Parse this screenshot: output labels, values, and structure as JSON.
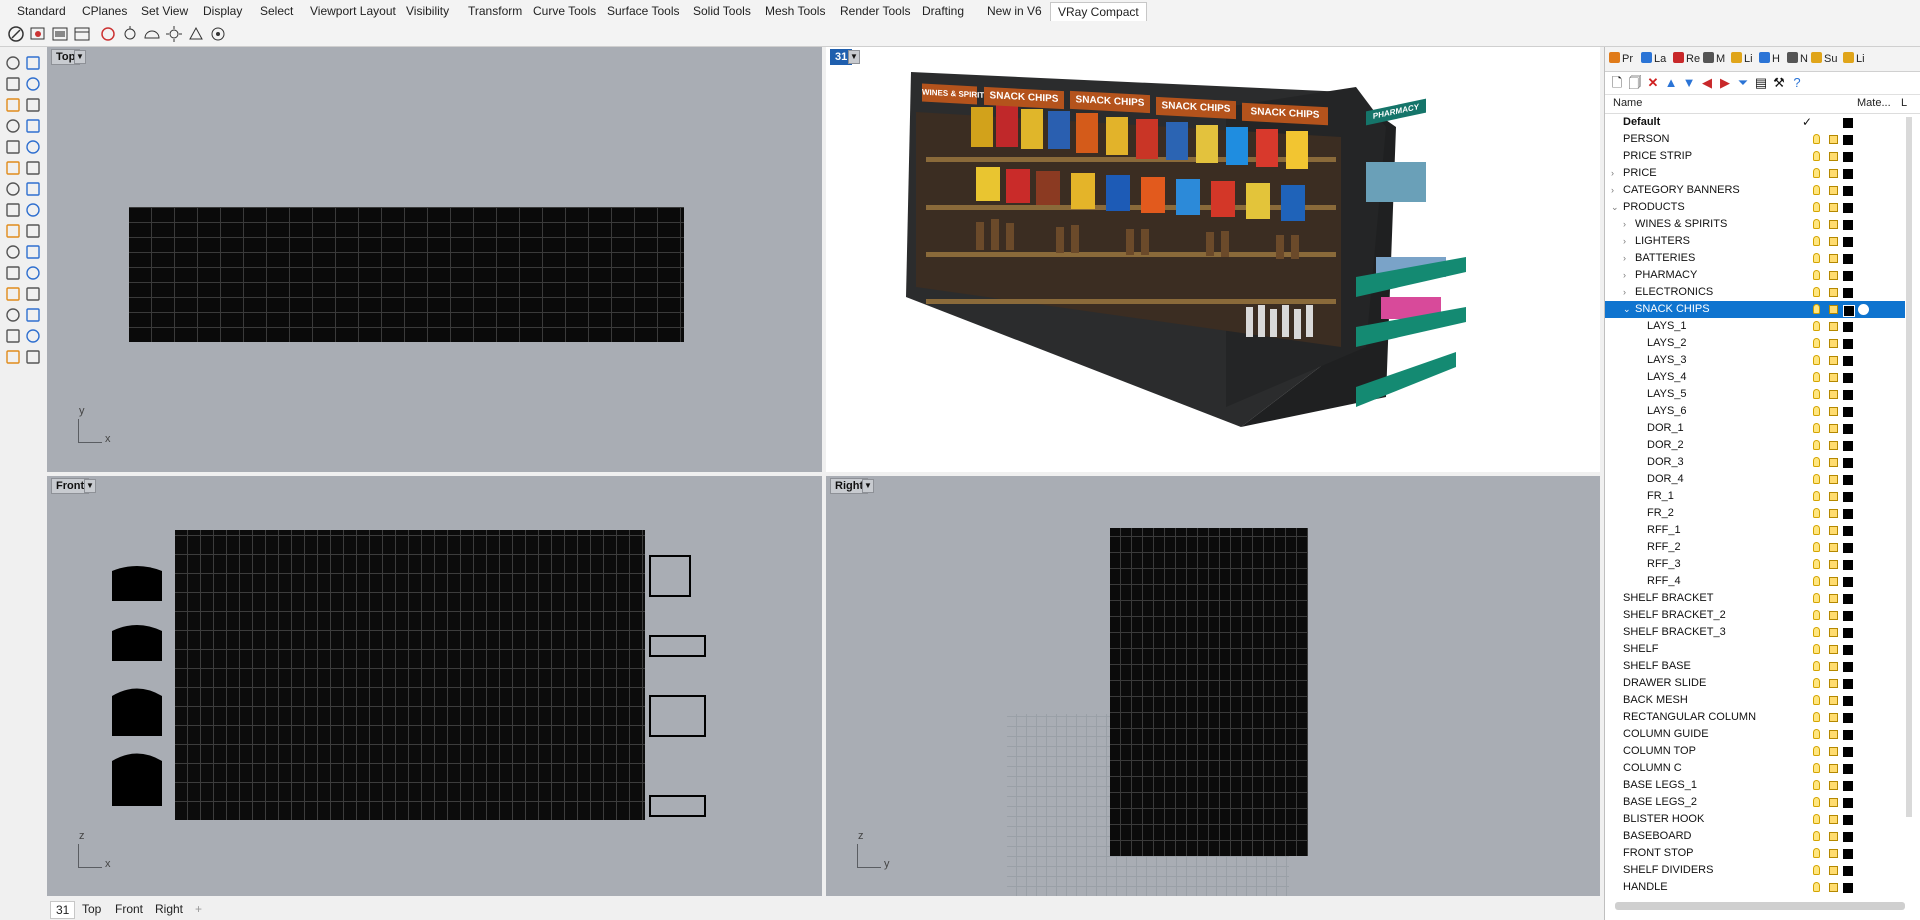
{
  "ribbon_tabs": [
    "Standard",
    "CPlanes",
    "Set View",
    "Display",
    "Select",
    "Viewport Layout",
    "Visibility",
    "Transform",
    "Curve Tools",
    "Surface Tools",
    "Solid Tools",
    "Mesh Tools",
    "Render Tools",
    "Drafting",
    "New in V6",
    "VRay Compact"
  ],
  "ribbon_active": "VRay Compact",
  "viewports": {
    "top": {
      "label": "Top",
      "axis_v": "y",
      "axis_h": "x"
    },
    "perspective": {
      "label": "31"
    },
    "front": {
      "label": "Front",
      "axis_v": "z",
      "axis_h": "x"
    },
    "right": {
      "label": "Right",
      "axis_v": "z",
      "axis_h": "y"
    }
  },
  "render_text": {
    "wines": "WINES & SPIRITS",
    "snack1": "SNACK CHIPS",
    "snack2": "SNACK CHIPS",
    "snack3": "SNACK CHIPS",
    "snack4": "SNACK CHIPS",
    "pharmacy": "PHARMACY"
  },
  "viewport_tabs": [
    "31",
    "Top",
    "Front",
    "Right"
  ],
  "panel": {
    "tabs": [
      "Pr",
      "La",
      "Re",
      "M",
      "Li",
      "H",
      "N",
      "Su",
      "Li"
    ],
    "columns": {
      "name": "Name",
      "material": "Mate...",
      "extra": "L"
    },
    "layers": [
      {
        "name": "Default",
        "depth": 0,
        "expander": "",
        "bold": true,
        "current": true
      },
      {
        "name": "PERSON",
        "depth": 0,
        "expander": ""
      },
      {
        "name": "PRICE STRIP",
        "depth": 0,
        "expander": ""
      },
      {
        "name": "PRICE",
        "depth": 0,
        "expander": ">"
      },
      {
        "name": "CATEGORY BANNERS",
        "depth": 0,
        "expander": ">"
      },
      {
        "name": "PRODUCTS",
        "depth": 0,
        "expander": "v"
      },
      {
        "name": "WINES & SPIRITS",
        "depth": 1,
        "expander": ">"
      },
      {
        "name": "LIGHTERS",
        "depth": 1,
        "expander": ">"
      },
      {
        "name": "BATTERIES",
        "depth": 1,
        "expander": ">"
      },
      {
        "name": "PHARMACY",
        "depth": 1,
        "expander": ">"
      },
      {
        "name": "ELECTRONICS",
        "depth": 1,
        "expander": ">"
      },
      {
        "name": "SNACK CHIPS",
        "depth": 1,
        "expander": "v",
        "selected": true
      },
      {
        "name": "LAYS_1",
        "depth": 2,
        "expander": ""
      },
      {
        "name": "LAYS_2",
        "depth": 2,
        "expander": ""
      },
      {
        "name": "LAYS_3",
        "depth": 2,
        "expander": ""
      },
      {
        "name": "LAYS_4",
        "depth": 2,
        "expander": ""
      },
      {
        "name": "LAYS_5",
        "depth": 2,
        "expander": ""
      },
      {
        "name": "LAYS_6",
        "depth": 2,
        "expander": ""
      },
      {
        "name": "DOR_1",
        "depth": 2,
        "expander": ""
      },
      {
        "name": "DOR_2",
        "depth": 2,
        "expander": ""
      },
      {
        "name": "DOR_3",
        "depth": 2,
        "expander": ""
      },
      {
        "name": "DOR_4",
        "depth": 2,
        "expander": ""
      },
      {
        "name": "FR_1",
        "depth": 2,
        "expander": ""
      },
      {
        "name": "FR_2",
        "depth": 2,
        "expander": ""
      },
      {
        "name": "RFF_1",
        "depth": 2,
        "expander": ""
      },
      {
        "name": "RFF_2",
        "depth": 2,
        "expander": ""
      },
      {
        "name": "RFF_3",
        "depth": 2,
        "expander": ""
      },
      {
        "name": "RFF_4",
        "depth": 2,
        "expander": ""
      },
      {
        "name": "SHELF BRACKET",
        "depth": 0,
        "expander": ""
      },
      {
        "name": "SHELF BRACKET_2",
        "depth": 0,
        "expander": ""
      },
      {
        "name": "SHELF BRACKET_3",
        "depth": 0,
        "expander": ""
      },
      {
        "name": "SHELF",
        "depth": 0,
        "expander": ""
      },
      {
        "name": "SHELF BASE",
        "depth": 0,
        "expander": ""
      },
      {
        "name": "DRAWER SLIDE",
        "depth": 0,
        "expander": ""
      },
      {
        "name": "BACK MESH",
        "depth": 0,
        "expander": ""
      },
      {
        "name": "RECTANGULAR COLUMN",
        "depth": 0,
        "expander": ""
      },
      {
        "name": "COLUMN GUIDE",
        "depth": 0,
        "expander": ""
      },
      {
        "name": "COLUMN TOP",
        "depth": 0,
        "expander": ""
      },
      {
        "name": "COLUMN C",
        "depth": 0,
        "expander": ""
      },
      {
        "name": "BASE LEGS_1",
        "depth": 0,
        "expander": ""
      },
      {
        "name": "BASE LEGS_2",
        "depth": 0,
        "expander": ""
      },
      {
        "name": "BLISTER HOOK",
        "depth": 0,
        "expander": ""
      },
      {
        "name": "BASEBOARD",
        "depth": 0,
        "expander": ""
      },
      {
        "name": "FRONT STOP",
        "depth": 0,
        "expander": ""
      },
      {
        "name": "SHELF DIVIDERS",
        "depth": 0,
        "expander": ""
      },
      {
        "name": "HANDLE",
        "depth": 0,
        "expander": ""
      }
    ]
  },
  "colors": {
    "selection": "#0f74cf",
    "viewport_bg": "#a9adb4",
    "banner": "#b4531c",
    "banner_alt": "#15756a"
  }
}
